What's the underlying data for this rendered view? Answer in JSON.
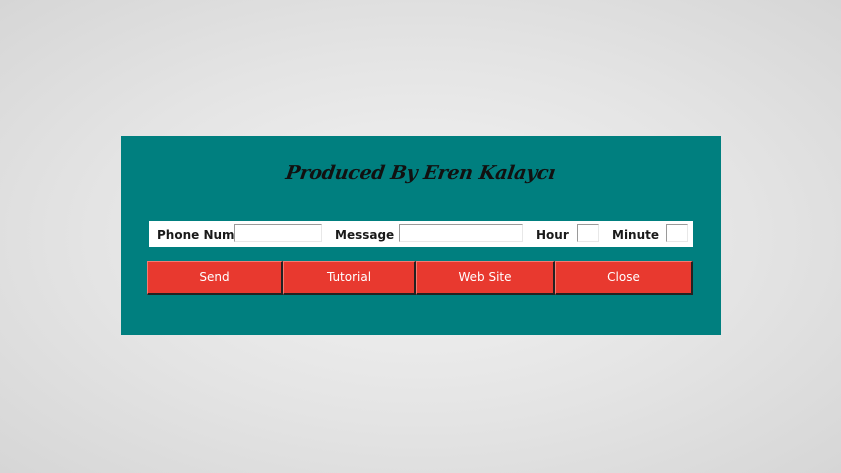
{
  "title": "Produced By Eren Kalaycı",
  "form": {
    "phone_label": "Phone Num",
    "phone_value": "",
    "message_label": "Message",
    "message_value": "",
    "hour_label": "Hour",
    "hour_value": "",
    "minute_label": "Minute",
    "minute_value": ""
  },
  "buttons": {
    "send": "Send",
    "tutorial": "Tutorial",
    "website": "Web Site",
    "close": "Close"
  },
  "colors": {
    "window_bg": "#007f7f",
    "button_bg": "#e8392f",
    "form_bg": "#ffffff"
  }
}
